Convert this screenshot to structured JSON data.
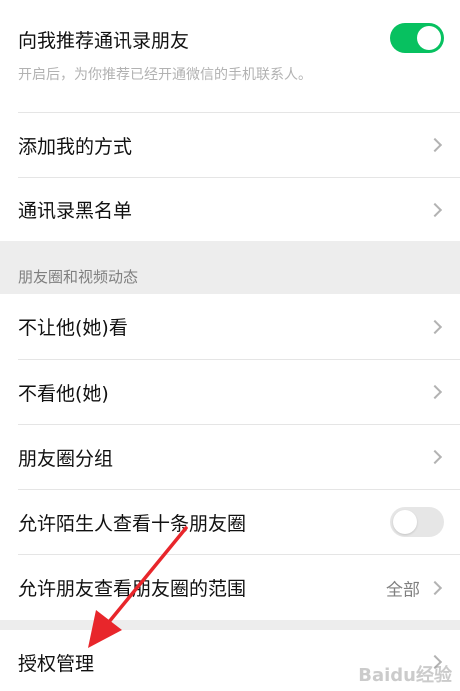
{
  "group1": {
    "recommend_contacts": {
      "label": "向我推荐通讯录朋友",
      "description": "开启后，为你推荐已经开通微信的手机联系人。",
      "enabled": true
    },
    "add_me_methods": {
      "label": "添加我的方式"
    },
    "contacts_blacklist": {
      "label": "通讯录黑名单"
    }
  },
  "moments_section": {
    "header": "朋友圈和视频动态",
    "items": [
      {
        "label": "不让他(她)看"
      },
      {
        "label": "不看他(她)"
      },
      {
        "label": "朋友圈分组"
      }
    ],
    "allow_strangers": {
      "label": "允许陌生人查看十条朋友圈",
      "enabled": false
    },
    "visibility_range": {
      "label": "允许朋友查看朋友圈的范围",
      "value": "全部"
    }
  },
  "group3": {
    "authorization": {
      "label": "授权管理"
    }
  },
  "watermark": {
    "text": "Baidu经验"
  },
  "colors": {
    "accent_green": "#07c160",
    "annotation_red": "#e8262b",
    "background": "#ededed"
  }
}
